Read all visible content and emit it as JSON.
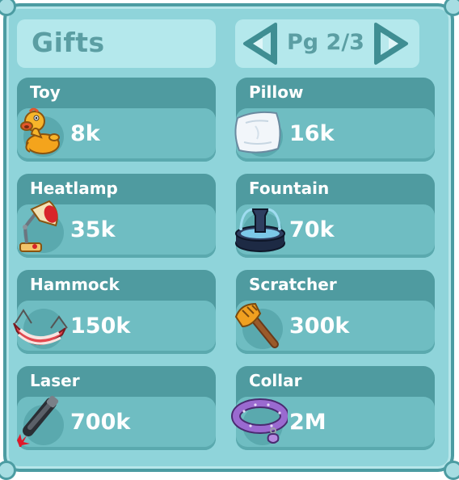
{
  "header": {
    "title": "Gifts",
    "page_label": "Pg 2/3"
  },
  "colors": {
    "panel": "#8fd4da",
    "border": "#4c9ca2",
    "card_dark": "#4f9ba0",
    "card_light": "#6fbdc2",
    "header_text": "#5b9ea3"
  },
  "gifts": [
    {
      "name": "Toy",
      "price": "8k",
      "icon": "rubber-duck-icon"
    },
    {
      "name": "Pillow",
      "price": "16k",
      "icon": "pillow-icon"
    },
    {
      "name": "Heatlamp",
      "price": "35k",
      "icon": "heatlamp-icon"
    },
    {
      "name": "Fountain",
      "price": "70k",
      "icon": "fountain-icon"
    },
    {
      "name": "Hammock",
      "price": "150k",
      "icon": "hammock-icon"
    },
    {
      "name": "Scratcher",
      "price": "300k",
      "icon": "scratcher-icon"
    },
    {
      "name": "Laser",
      "price": "700k",
      "icon": "laser-pointer-icon"
    },
    {
      "name": "Collar",
      "price": "2M",
      "icon": "collar-icon"
    }
  ]
}
